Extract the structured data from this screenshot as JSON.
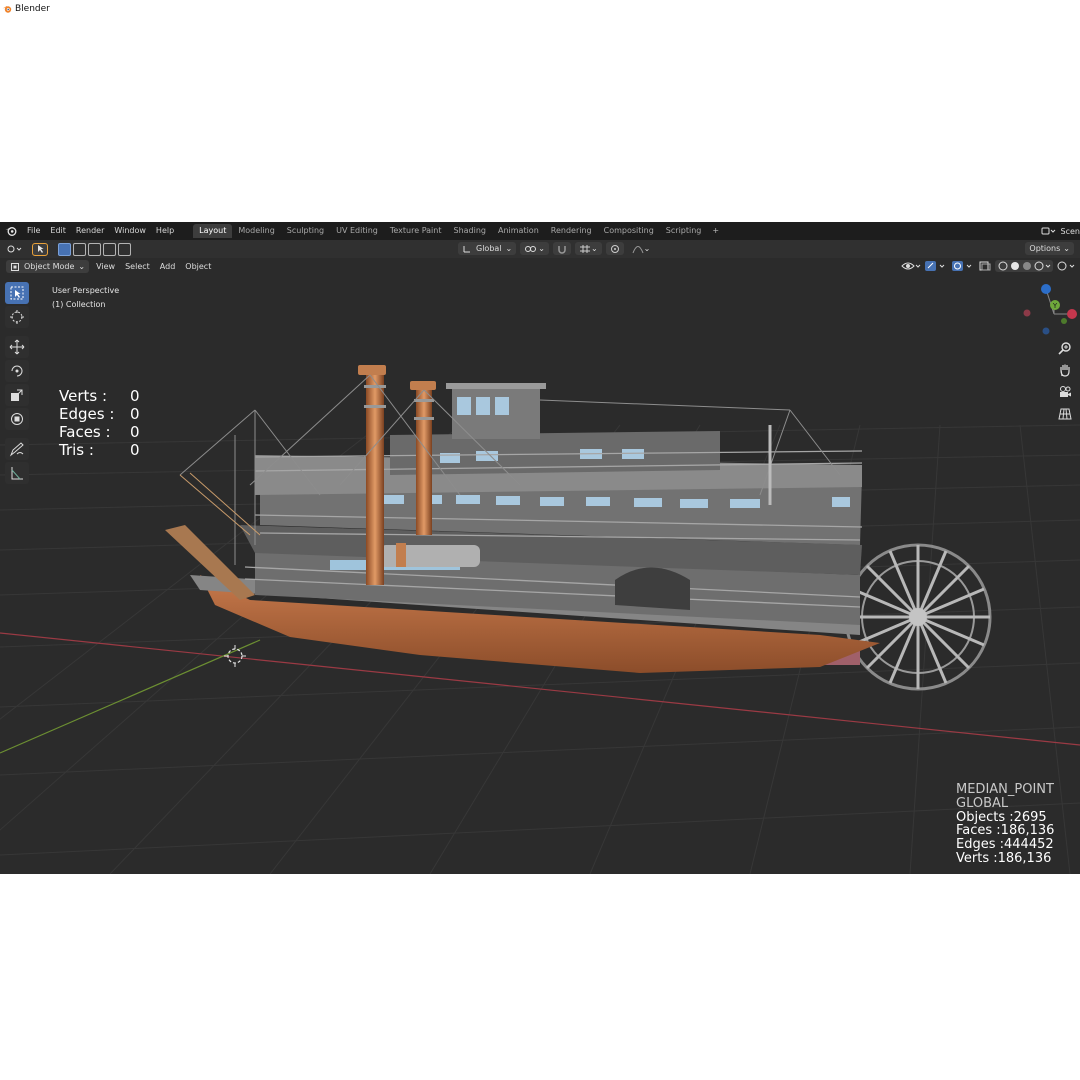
{
  "window": {
    "title": "Blender"
  },
  "menubar": {
    "items": [
      "File",
      "Edit",
      "Render",
      "Window",
      "Help"
    ],
    "workspaces": [
      {
        "label": "Layout",
        "active": true
      },
      {
        "label": "Modeling",
        "active": false
      },
      {
        "label": "Sculpting",
        "active": false
      },
      {
        "label": "UV Editing",
        "active": false
      },
      {
        "label": "Texture Paint",
        "active": false
      },
      {
        "label": "Shading",
        "active": false
      },
      {
        "label": "Animation",
        "active": false
      },
      {
        "label": "Rendering",
        "active": false
      },
      {
        "label": "Compositing",
        "active": false
      },
      {
        "label": "Scripting",
        "active": false
      }
    ],
    "add_tab": "+",
    "scene_label": "Scen"
  },
  "toolheader": {
    "orientation_label": "Global",
    "options_label": "Options"
  },
  "viewheader": {
    "mode_label": "Object Mode",
    "menus": [
      "View",
      "Select",
      "Add",
      "Object"
    ]
  },
  "viewport": {
    "perspective_label": "User Perspective",
    "collection_label": "(1) Collection",
    "stats_left": [
      {
        "label": "Verts :",
        "value": "0"
      },
      {
        "label": "Edges :",
        "value": "0"
      },
      {
        "label": "Faces :",
        "value": "0"
      },
      {
        "label": "Tris :",
        "value": "0"
      }
    ],
    "stats_right": {
      "pivot": "MEDIAN_POINT",
      "orientation": "GLOBAL",
      "objects": "Objects :2695",
      "faces": "Faces :186,136",
      "edges": "Edges :444452",
      "verts": "Verts :186,136"
    },
    "gizmo_labels": {
      "y": "Y"
    }
  },
  "colors": {
    "accent": "#4772b3",
    "background": "#2b2b2b",
    "grid": "#3a3a3a",
    "x_axis": "#9b3a44",
    "y_axis": "#6c8f32",
    "hull": "#b8683e",
    "cabin": "#6e6e6e"
  }
}
